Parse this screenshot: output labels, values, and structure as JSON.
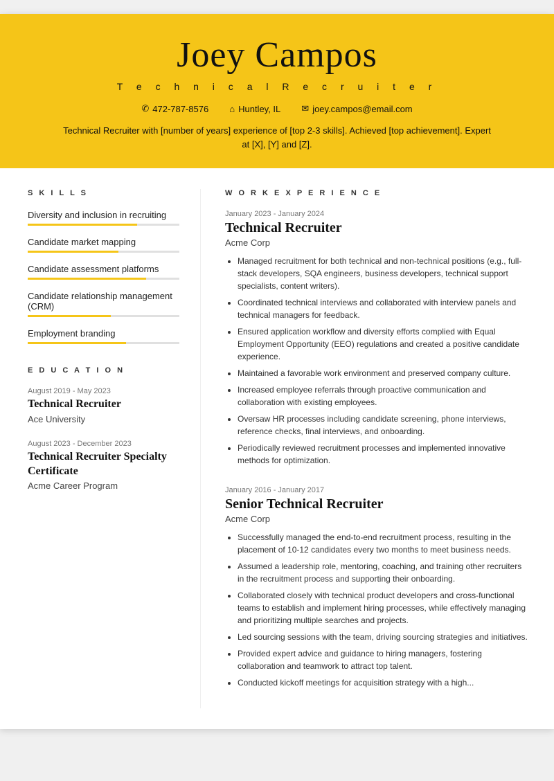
{
  "header": {
    "name": "Joey Campos",
    "title": "T e c h n i c a l   R e c r u i t e r",
    "phone": "472-787-8576",
    "location": "Huntley, IL",
    "email": "joey.campos@email.com",
    "summary": "Technical Recruiter with [number of years] experience of [top 2-3 skills]. Achieved [top achievement]. Expert at [X], [Y] and [Z]."
  },
  "skills": {
    "section_title": "S K I L L S",
    "items": [
      {
        "name": "Diversity and inclusion in recruiting",
        "fill_pct": 72
      },
      {
        "name": "Candidate market mapping",
        "fill_pct": 60
      },
      {
        "name": "Candidate assessment platforms",
        "fill_pct": 78
      },
      {
        "name": "Candidate relationship management (CRM)",
        "fill_pct": 55
      },
      {
        "name": "Employment branding",
        "fill_pct": 65
      }
    ]
  },
  "education": {
    "section_title": "E D U C A T I O N",
    "items": [
      {
        "date": "August 2019 - May 2023",
        "degree": "Technical Recruiter",
        "school": "Ace University"
      },
      {
        "date": "August 2023 - December 2023",
        "degree": "Technical Recruiter Specialty Certificate",
        "school": "Acme Career Program"
      }
    ]
  },
  "work": {
    "section_title": "W O R K   E X P E R I E N C E",
    "items": [
      {
        "date": "January 2023 - January 2024",
        "title": "Technical Recruiter",
        "company": "Acme Corp",
        "bullets": [
          "Managed recruitment for both technical and non-technical positions (e.g., full-stack developers, SQA engineers, business developers, technical support specialists, content writers).",
          "Coordinated technical interviews and collaborated with interview panels and technical managers for feedback.",
          "Ensured application workflow and diversity efforts complied with Equal Employment Opportunity (EEO) regulations and created a positive candidate experience.",
          "Maintained a favorable work environment and preserved company culture.",
          "Increased employee referrals through proactive communication and collaboration with existing employees.",
          "Oversaw HR processes including candidate screening, phone interviews, reference checks, final interviews, and onboarding.",
          "Periodically reviewed recruitment processes and implemented innovative methods for optimization."
        ]
      },
      {
        "date": "January 2016 - January 2017",
        "title": "Senior Technical Recruiter",
        "company": "Acme Corp",
        "bullets": [
          "Successfully managed the end-to-end recruitment process, resulting in the placement of 10-12 candidates every two months to meet business needs.",
          "Assumed a leadership role, mentoring, coaching, and training other recruiters in the recruitment process and supporting their onboarding.",
          "Collaborated closely with technical product developers and cross-functional teams to establish and implement hiring processes, while effectively managing and prioritizing multiple searches and projects.",
          "Led sourcing sessions with the team, driving sourcing strategies and initiatives.",
          "Provided expert advice and guidance to hiring managers, fostering collaboration and teamwork to attract top talent.",
          "Conducted kickoff meetings for acquisition strategy with a high..."
        ]
      }
    ]
  }
}
